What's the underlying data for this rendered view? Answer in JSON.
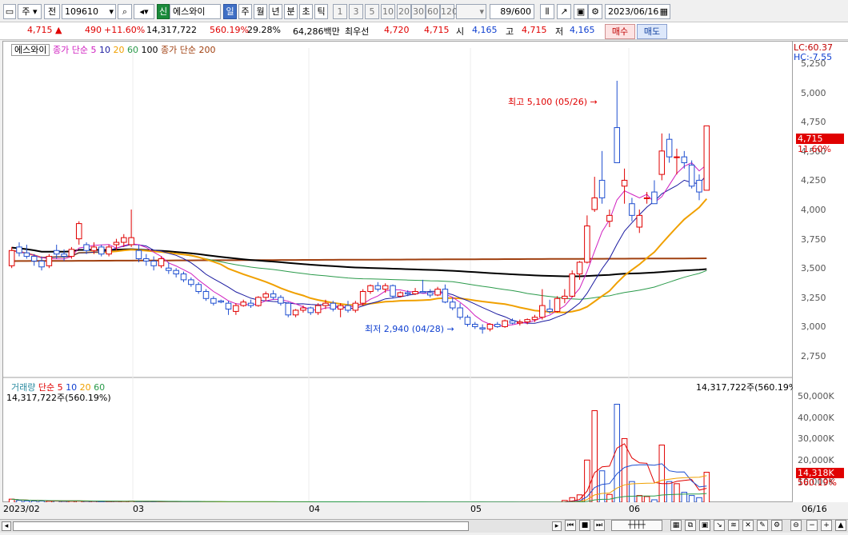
{
  "toolbar": {
    "market": "주",
    "period_prefix": "전",
    "code": "109610",
    "credit_badge": "신",
    "stock_name": "에스와이",
    "periods": [
      "일",
      "주",
      "월",
      "년",
      "분",
      "초",
      "틱"
    ],
    "active_period": "일",
    "intervals": [
      "1",
      "3",
      "5",
      "10",
      "20",
      "30",
      "60",
      "120"
    ],
    "count": "89",
    "count_total": "/600",
    "date": "2023/06/16"
  },
  "quote": {
    "price": "4,715",
    "change": "490",
    "change_pct": "+11.60%",
    "volume": "14,317,722",
    "volume_ratio": "560.19%",
    "turnover": "29.28%",
    "amount": "64,286백만",
    "best_ask_label": "최우선",
    "best_ask": "4,720",
    "best_bid": "4,715",
    "open_label": "시",
    "open": "4,165",
    "high_label": "고",
    "high": "4,715",
    "low_label": "저",
    "low": "4,165",
    "buy_label": "매수",
    "sell_label": "매도"
  },
  "price_panel": {
    "name": "에스와이",
    "ma_label": "종가 단순",
    "ma_periods": [
      "5",
      "10",
      "20",
      "60",
      "100"
    ],
    "ma200_label": "종가 단순 200",
    "lc": "LC:60.37",
    "hc": "HC:-7.55",
    "max_label": "최고 5,100 (05/26)",
    "min_label": "최저 2,940 (04/28)",
    "current_price_tag": "4,715",
    "current_pct_tag": "11.60%"
  },
  "volume_panel": {
    "name": "거래량",
    "ma_label": "단순",
    "ma_periods": [
      "5",
      "10",
      "20",
      "60"
    ],
    "left_info": "14,317,722주(560.19%)",
    "right_info": "14,317,722주(560.19%)",
    "current_tag": "14,318K",
    "current_pct_tag": "560.19%"
  },
  "colors": {
    "up": "#e00000",
    "down": "#1f4fd0",
    "ma5": "#d020c0",
    "ma10": "#1a1aa0",
    "ma20": "#f0a000",
    "ma60": "#2a9a4a",
    "ma100": "#000000",
    "ma200": "#a04010"
  },
  "chart_data": {
    "type": "candlestick",
    "price_axis_ticks": [
      "5,250",
      "5,000",
      "4,750",
      "4,500",
      "4,250",
      "4,000",
      "3,750",
      "3,500",
      "3,250",
      "3,000",
      "2,750"
    ],
    "volume_axis_ticks": [
      "50,000K",
      "40,000K",
      "30,000K",
      "20,000K",
      "10,000K"
    ],
    "x_labels": [
      "2023/02",
      "03",
      "04",
      "05",
      "06",
      "06/16"
    ],
    "ylim": [
      2600,
      5380
    ],
    "volume_ylim": [
      0,
      54000
    ],
    "candles": [
      [
        3520,
        3680,
        3500,
        3650
      ],
      [
        3680,
        3720,
        3600,
        3630
      ],
      [
        3630,
        3700,
        3580,
        3600
      ],
      [
        3600,
        3620,
        3520,
        3560
      ],
      [
        3560,
        3600,
        3480,
        3510
      ],
      [
        3520,
        3620,
        3500,
        3600
      ],
      [
        3650,
        3700,
        3580,
        3620
      ],
      [
        3620,
        3660,
        3560,
        3600
      ],
      [
        3600,
        3680,
        3580,
        3660
      ],
      [
        3750,
        3900,
        3700,
        3880
      ],
      [
        3700,
        3720,
        3620,
        3650
      ],
      [
        3650,
        3720,
        3620,
        3680
      ],
      [
        3680,
        3700,
        3600,
        3620
      ],
      [
        3620,
        3700,
        3600,
        3680
      ],
      [
        3700,
        3750,
        3650,
        3720
      ],
      [
        3720,
        3790,
        3680,
        3760
      ],
      [
        3700,
        4000,
        3680,
        3760
      ],
      [
        3650,
        3700,
        3550,
        3580
      ],
      [
        3580,
        3620,
        3520,
        3560
      ],
      [
        3560,
        3600,
        3480,
        3520
      ],
      [
        3520,
        3600,
        3500,
        3580
      ],
      [
        3500,
        3550,
        3450,
        3480
      ],
      [
        3480,
        3500,
        3420,
        3450
      ],
      [
        3450,
        3470,
        3380,
        3400
      ],
      [
        3400,
        3420,
        3340,
        3360
      ],
      [
        3360,
        3380,
        3280,
        3300
      ],
      [
        3300,
        3320,
        3220,
        3240
      ],
      [
        3240,
        3260,
        3180,
        3200
      ],
      [
        3220,
        3230,
        3200,
        3210
      ],
      [
        3200,
        3220,
        3100,
        3150
      ],
      [
        3130,
        3200,
        3100,
        3180
      ],
      [
        3180,
        3230,
        3170,
        3210
      ],
      [
        3200,
        3230,
        3160,
        3180
      ],
      [
        3180,
        3260,
        3170,
        3250
      ],
      [
        3250,
        3300,
        3220,
        3280
      ],
      [
        3280,
        3310,
        3230,
        3250
      ],
      [
        3250,
        3270,
        3180,
        3200
      ],
      [
        3200,
        3210,
        3080,
        3100
      ],
      [
        3100,
        3150,
        3080,
        3140
      ],
      [
        3140,
        3180,
        3120,
        3160
      ],
      [
        3160,
        3170,
        3100,
        3120
      ],
      [
        3120,
        3200,
        3100,
        3180
      ],
      [
        3180,
        3230,
        3150,
        3200
      ],
      [
        3200,
        3220,
        3130,
        3150
      ],
      [
        3150,
        3200,
        3080,
        3180
      ],
      [
        3180,
        3220,
        3120,
        3140
      ],
      [
        3140,
        3220,
        3120,
        3200
      ],
      [
        3200,
        3320,
        3180,
        3300
      ],
      [
        3300,
        3360,
        3280,
        3350
      ],
      [
        3350,
        3380,
        3300,
        3320
      ],
      [
        3320,
        3370,
        3290,
        3350
      ],
      [
        3350,
        3360,
        3240,
        3260
      ],
      [
        3260,
        3300,
        3250,
        3290
      ],
      [
        3290,
        3310,
        3260,
        3280
      ],
      [
        3280,
        3330,
        3270,
        3300
      ],
      [
        3300,
        3400,
        3290,
        3290
      ],
      [
        3290,
        3320,
        3250,
        3270
      ],
      [
        3270,
        3340,
        3260,
        3320
      ],
      [
        3320,
        3360,
        3200,
        3210
      ],
      [
        3210,
        3250,
        3140,
        3160
      ],
      [
        3160,
        3200,
        3060,
        3080
      ],
      [
        3080,
        3100,
        3000,
        3020
      ],
      [
        3020,
        3040,
        2980,
        3000
      ],
      [
        2990,
        3020,
        2940,
        2980
      ],
      [
        2980,
        3030,
        2960,
        3020
      ],
      [
        3020,
        3040,
        2990,
        3000
      ],
      [
        3000,
        3060,
        2990,
        3050
      ],
      [
        3050,
        3070,
        3020,
        3030
      ],
      [
        3030,
        3060,
        3010,
        3040
      ],
      [
        3040,
        3070,
        3020,
        3060
      ],
      [
        3060,
        3100,
        3040,
        3080
      ],
      [
        3080,
        3320,
        3060,
        3180
      ],
      [
        3150,
        3230,
        3110,
        3130
      ],
      [
        3130,
        3260,
        3120,
        3240
      ],
      [
        3240,
        3320,
        3200,
        3260
      ],
      [
        3260,
        3480,
        3250,
        3450
      ],
      [
        3450,
        3560,
        3400,
        3550
      ],
      [
        3550,
        3950,
        3540,
        3860
      ],
      [
        4000,
        4280,
        3980,
        4100
      ],
      [
        4250,
        4500,
        4050,
        4100
      ],
      [
        3900,
        4000,
        3850,
        3950
      ],
      [
        4700,
        5100,
        4550,
        4400
      ],
      [
        4200,
        4350,
        4050,
        4250
      ],
      [
        4050,
        4100,
        3900,
        3950
      ],
      [
        3850,
        4000,
        3800,
        3950
      ],
      [
        4100,
        4150,
        4050,
        4100
      ],
      [
        4150,
        4250,
        4050,
        4050
      ],
      [
        4300,
        4650,
        4250,
        4500
      ],
      [
        4600,
        4650,
        4400,
        4450
      ],
      [
        4450,
        4520,
        4300,
        4450
      ],
      [
        4450,
        4500,
        4350,
        4400
      ],
      [
        4380,
        4420,
        4180,
        4200
      ],
      [
        4250,
        4300,
        4080,
        4150
      ],
      [
        4165,
        4715,
        4165,
        4715
      ]
    ],
    "volume": [
      1800,
      1200,
      1000,
      900,
      900,
      800,
      900,
      700,
      800,
      900,
      700,
      700,
      600,
      600,
      700,
      700,
      900,
      600,
      500,
      500,
      500,
      500,
      400,
      400,
      400,
      400,
      400,
      400,
      300,
      300,
      300,
      300,
      300,
      300,
      300,
      300,
      300,
      300,
      300,
      300,
      300,
      300,
      300,
      300,
      300,
      300,
      300,
      300,
      300,
      300,
      300,
      300,
      300,
      300,
      300,
      300,
      300,
      300,
      300,
      300,
      300,
      300,
      300,
      300,
      300,
      300,
      300,
      300,
      300,
      300,
      300,
      300,
      300,
      300,
      1200,
      2500,
      3800,
      20000,
      43000,
      15000,
      4000,
      46000,
      30000,
      10000,
      3500,
      3000,
      1500,
      27000,
      10000,
      9000,
      5000,
      3500,
      2500,
      14318
    ]
  }
}
